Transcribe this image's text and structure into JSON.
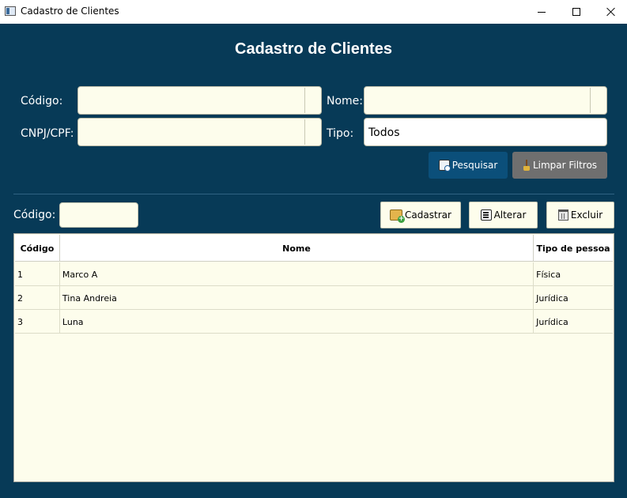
{
  "window": {
    "title": "Cadastro de Clientes"
  },
  "form": {
    "heading": "Cadastro de Clientes",
    "codigo_label": "Código:",
    "nome_label": "Nome:",
    "cnpj_label": "CNPJ/CPF:",
    "tipo_label": "Tipo:",
    "tipo_value": "Todos",
    "search_button": "Pesquisar",
    "clear_button": "Limpar Filtros"
  },
  "actions": {
    "codigo_label": "Código:",
    "add_button": "Cadastrar",
    "edit_button": "Alterar",
    "delete_button": "Excluir"
  },
  "table": {
    "columns": [
      "Código",
      "Nome",
      "Tipo de pessoa"
    ],
    "rows": [
      [
        "1",
        "Marco A",
        "Física"
      ],
      [
        "2",
        "Tina Andreia",
        "Jurídica"
      ],
      [
        "3",
        "Luna",
        "Jurídica"
      ]
    ]
  },
  "colors": {
    "background": "#073a57",
    "field": "#fdfdec",
    "primary_button": "#0b4f7a",
    "secondary_button": "#6f6f6f"
  }
}
